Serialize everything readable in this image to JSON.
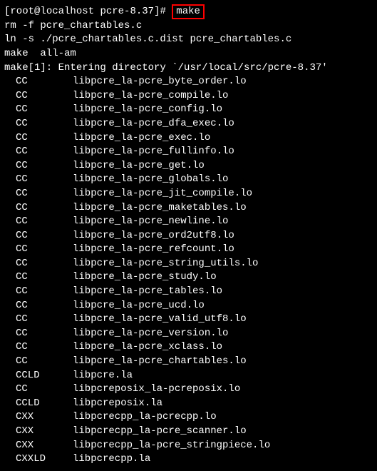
{
  "prompt": {
    "user": "root",
    "host": "localhost",
    "cwd": "pcre-8.37",
    "symbol": "#",
    "command": "make"
  },
  "prelines": [
    "rm -f pcre_chartables.c",
    "ln -s ./pcre_chartables.c.dist pcre_chartables.c",
    "make  all-am",
    "make[1]: Entering directory `/usr/local/src/pcre-8.37'"
  ],
  "compile": [
    {
      "tag": "CC",
      "file": "libpcre_la-pcre_byte_order.lo"
    },
    {
      "tag": "CC",
      "file": "libpcre_la-pcre_compile.lo"
    },
    {
      "tag": "CC",
      "file": "libpcre_la-pcre_config.lo"
    },
    {
      "tag": "CC",
      "file": "libpcre_la-pcre_dfa_exec.lo"
    },
    {
      "tag": "CC",
      "file": "libpcre_la-pcre_exec.lo"
    },
    {
      "tag": "CC",
      "file": "libpcre_la-pcre_fullinfo.lo"
    },
    {
      "tag": "CC",
      "file": "libpcre_la-pcre_get.lo"
    },
    {
      "tag": "CC",
      "file": "libpcre_la-pcre_globals.lo"
    },
    {
      "tag": "CC",
      "file": "libpcre_la-pcre_jit_compile.lo"
    },
    {
      "tag": "CC",
      "file": "libpcre_la-pcre_maketables.lo"
    },
    {
      "tag": "CC",
      "file": "libpcre_la-pcre_newline.lo"
    },
    {
      "tag": "CC",
      "file": "libpcre_la-pcre_ord2utf8.lo"
    },
    {
      "tag": "CC",
      "file": "libpcre_la-pcre_refcount.lo"
    },
    {
      "tag": "CC",
      "file": "libpcre_la-pcre_string_utils.lo"
    },
    {
      "tag": "CC",
      "file": "libpcre_la-pcre_study.lo"
    },
    {
      "tag": "CC",
      "file": "libpcre_la-pcre_tables.lo"
    },
    {
      "tag": "CC",
      "file": "libpcre_la-pcre_ucd.lo"
    },
    {
      "tag": "CC",
      "file": "libpcre_la-pcre_valid_utf8.lo"
    },
    {
      "tag": "CC",
      "file": "libpcre_la-pcre_version.lo"
    },
    {
      "tag": "CC",
      "file": "libpcre_la-pcre_xclass.lo"
    },
    {
      "tag": "CC",
      "file": "libpcre_la-pcre_chartables.lo"
    },
    {
      "tag": "CCLD",
      "file": "libpcre.la"
    },
    {
      "tag": "CC",
      "file": "libpcreposix_la-pcreposix.lo"
    },
    {
      "tag": "CCLD",
      "file": "libpcreposix.la"
    },
    {
      "tag": "CXX",
      "file": "libpcrecpp_la-pcrecpp.lo"
    },
    {
      "tag": "CXX",
      "file": "libpcrecpp_la-pcre_scanner.lo"
    },
    {
      "tag": "CXX",
      "file": "libpcrecpp_la-pcre_stringpiece.lo"
    },
    {
      "tag": "CXXLD",
      "file": "libpcrecpp.la"
    }
  ]
}
